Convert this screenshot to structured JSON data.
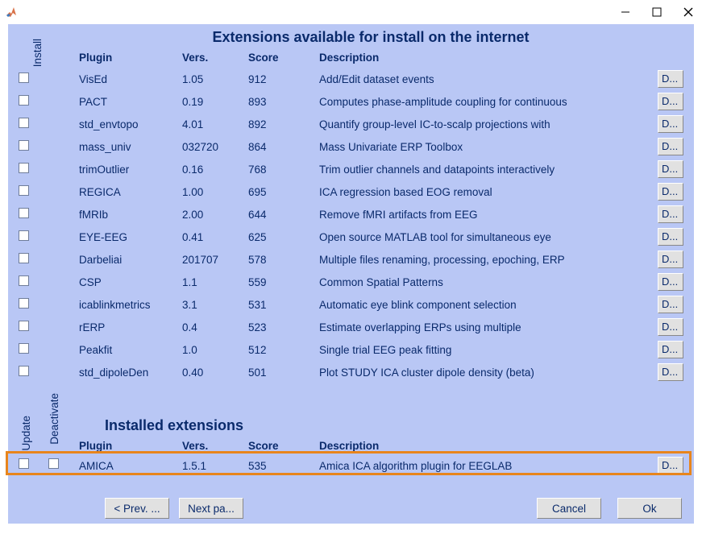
{
  "titles": {
    "available": "Extensions available for install on the internet",
    "installed": "Installed extensions"
  },
  "headers": {
    "plugin": "Plugin",
    "vers": "Vers.",
    "score": "Score",
    "desc": "Description"
  },
  "sideLabels": {
    "install": "Install",
    "update": "Update",
    "deactivate": "Deactivate"
  },
  "available": [
    {
      "plugin": "VisEd",
      "vers": "1.05",
      "score": "912",
      "desc": "Add/Edit dataset events",
      "d": "D..."
    },
    {
      "plugin": "PACT",
      "vers": "0.19",
      "score": "893",
      "desc": "Computes phase-amplitude coupling for continuous",
      "d": "D..."
    },
    {
      "plugin": "std_envtopo",
      "vers": "4.01",
      "score": "892",
      "desc": "Quantify group-level IC-to-scalp projections with",
      "d": "D..."
    },
    {
      "plugin": "mass_univ",
      "vers": "032720",
      "score": "864",
      "desc": "Mass Univariate ERP Toolbox",
      "d": "D..."
    },
    {
      "plugin": "trimOutlier",
      "vers": "0.16",
      "score": "768",
      "desc": "Trim outlier channels and datapoints interactively",
      "d": "D..."
    },
    {
      "plugin": "REGICA",
      "vers": "1.00",
      "score": "695",
      "desc": "ICA regression based EOG removal",
      "d": "D..."
    },
    {
      "plugin": "fMRIb",
      "vers": "2.00",
      "score": "644",
      "desc": "Remove fMRI artifacts from EEG",
      "d": "D..."
    },
    {
      "plugin": "EYE-EEG",
      "vers": "0.41",
      "score": "625",
      "desc": "Open source MATLAB tool for simultaneous eye",
      "d": "D..."
    },
    {
      "plugin": "Darbeliai",
      "vers": "201707",
      "score": "578",
      "desc": "Multiple files renaming, processing, epoching, ERP",
      "d": "D..."
    },
    {
      "plugin": "CSP",
      "vers": "1.1",
      "score": "559",
      "desc": "Common Spatial Patterns",
      "d": "D..."
    },
    {
      "plugin": "icablinkmetrics",
      "vers": "3.1",
      "score": "531",
      "desc": "Automatic eye blink component selection",
      "d": "D..."
    },
    {
      "plugin": "rERP",
      "vers": "0.4",
      "score": "523",
      "desc": "Estimate overlapping ERPs using multiple",
      "d": "D..."
    },
    {
      "plugin": "Peakfit",
      "vers": "1.0",
      "score": "512",
      "desc": "Single trial EEG peak fitting",
      "d": "D..."
    },
    {
      "plugin": "std_dipoleDen",
      "vers": "0.40",
      "score": "501",
      "desc": "Plot STUDY ICA cluster dipole density (beta)",
      "d": "D..."
    }
  ],
  "installed": [
    {
      "plugin": "AMICA",
      "vers": "1.5.1",
      "score": "535",
      "desc": "Amica ICA algorithm plugin for EEGLAB",
      "d": "D..."
    }
  ],
  "footer": {
    "prev": "< Prev. ...",
    "next": "Next pa...",
    "cancel": "Cancel",
    "ok": "Ok"
  }
}
